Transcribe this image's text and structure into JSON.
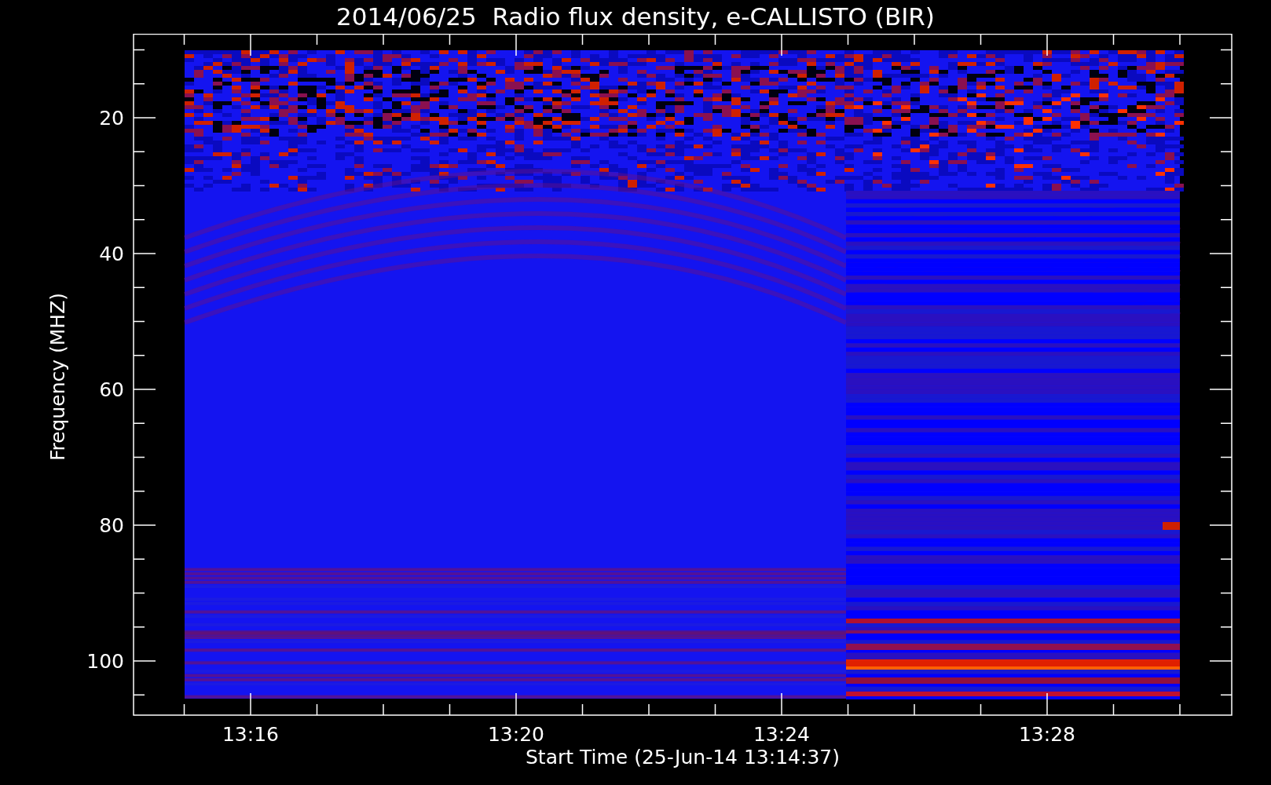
{
  "title": "2014/06/25  Radio flux density, e-CALLISTO (BIR)",
  "y_axis": {
    "label": "Frequency (MHZ)",
    "ticks": [
      "20",
      "40",
      "60",
      "80",
      "100"
    ]
  },
  "x_axis": {
    "label": "Start Time (25-Jun-14 13:14:37)",
    "ticks": [
      "13:16",
      "13:20",
      "13:24",
      "13:28"
    ]
  }
}
